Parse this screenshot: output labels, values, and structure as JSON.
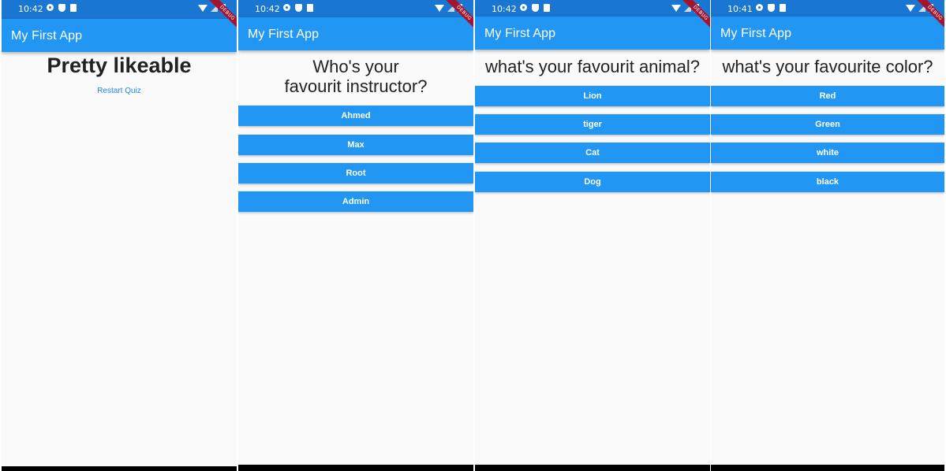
{
  "app_title": "My First App",
  "debug_label": "DEBUG",
  "screens": [
    {
      "status_time": "10:42",
      "result_text": "Pretty likeable",
      "restart_label": "Restart Quiz"
    },
    {
      "status_time": "10:42",
      "question": "Who's your favourit instructor?",
      "answers": [
        "Ahmed",
        "Max",
        "Root",
        "Admin"
      ]
    },
    {
      "status_time": "10:42",
      "question": "what's your favourit animal?",
      "answers": [
        "Lion",
        "tiger",
        "Cat",
        "Dog"
      ]
    },
    {
      "status_time": "10:41",
      "question": "what's your favourite color?",
      "answers": [
        "Red",
        "Green",
        "white",
        "black"
      ]
    }
  ],
  "colors": {
    "status_bar": "#1976d2",
    "app_bar": "#2196f3",
    "button": "#2196f3",
    "link": "#1e88e5",
    "debug_ribbon": "#a3152f"
  }
}
